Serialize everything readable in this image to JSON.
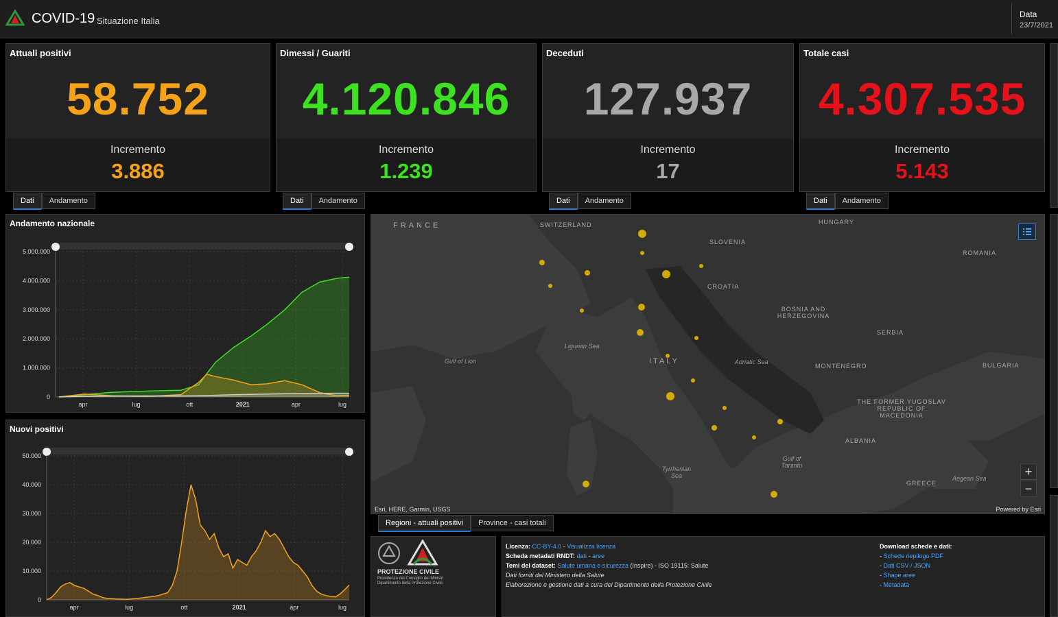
{
  "header": {
    "title": "COVID-19",
    "subtitle": "Situazione Italia",
    "date_label": "Data",
    "date_value": "23/7/2021"
  },
  "cards": [
    {
      "title": "Attuali positivi",
      "value": "58.752",
      "inc_label": "Incremento",
      "inc_value": "3.886",
      "color": "#f5a21b"
    },
    {
      "title": "Dimessi / Guariti",
      "value": "4.120.846",
      "inc_label": "Incremento",
      "inc_value": "1.239",
      "color": "#3ee022"
    },
    {
      "title": "Deceduti",
      "value": "127.937",
      "inc_label": "Incremento",
      "inc_value": "17",
      "color": "#a8a8a8"
    },
    {
      "title": "Totale casi",
      "value": "4.307.535",
      "inc_label": "Incremento",
      "inc_value": "5.143",
      "color": "#e3121b"
    }
  ],
  "card_tabs": {
    "dati": "Dati",
    "andamento": "Andamento"
  },
  "chart_data": [
    {
      "type": "area",
      "title": "Andamento nazionale",
      "x_ticks": [
        "apr",
        "lug",
        "ott",
        "2021",
        "apr",
        "lug"
      ],
      "y_ticks": [
        "5.000.000",
        "4.000.000",
        "3.000.000",
        "2.000.000",
        "1.000.000",
        "0"
      ],
      "ylim": [
        0,
        5000000
      ],
      "x_dates": [
        "2020-03-01",
        "2020-04-15",
        "2020-06-01",
        "2020-08-01",
        "2020-10-01",
        "2020-11-01",
        "2020-11-15",
        "2020-12-01",
        "2021-01-01",
        "2021-02-01",
        "2021-03-01",
        "2021-04-01",
        "2021-05-01",
        "2021-06-01",
        "2021-07-01",
        "2021-07-23"
      ],
      "series": [
        {
          "color": "#3ee022",
          "values": [
            0,
            80000,
            160000,
            200000,
            230000,
            420000,
            800000,
            1200000,
            1700000,
            2100000,
            2500000,
            3000000,
            3600000,
            3950000,
            4080000,
            4120846
          ]
        },
        {
          "color": "#f5a21b",
          "values": [
            0,
            100000,
            40000,
            15000,
            80000,
            500000,
            780000,
            700000,
            580000,
            420000,
            450000,
            560000,
            420000,
            150000,
            42000,
            58752
          ]
        },
        {
          "color": "#cccccc",
          "values": [
            0,
            22000,
            33000,
            35000,
            36000,
            40000,
            48000,
            58000,
            75000,
            90000,
            100000,
            110000,
            120000,
            126000,
            127700,
            127937
          ]
        }
      ]
    },
    {
      "type": "area",
      "title": "Nuovi positivi",
      "x_ticks": [
        "apr",
        "lug",
        "ott",
        "2021",
        "apr",
        "lug"
      ],
      "y_ticks": [
        "50.000",
        "40.000",
        "30.000",
        "20.000",
        "10.000",
        "0"
      ],
      "ylim": [
        0,
        50000
      ],
      "series": [
        {
          "color": "#f5a21b",
          "values": [
            0,
            800,
            2500,
            4500,
            5500,
            6000,
            5000,
            4500,
            4000,
            3000,
            2000,
            1500,
            800,
            500,
            400,
            300,
            250,
            200,
            300,
            400,
            600,
            800,
            1000,
            1200,
            1500,
            2000,
            2500,
            5000,
            10000,
            20000,
            31000,
            40000,
            35000,
            26000,
            24000,
            21000,
            23000,
            18000,
            15000,
            16000,
            11000,
            14000,
            13000,
            12000,
            15000,
            17000,
            20000,
            24000,
            22000,
            23000,
            21000,
            18000,
            15000,
            13000,
            12000,
            10000,
            8000,
            5000,
            3000,
            2000,
            1500,
            1200,
            1000,
            2000,
            3500,
            5143
          ]
        }
      ]
    }
  ],
  "map": {
    "labels": {
      "france": "FRANCE",
      "switzerland": "SWITZERLAND",
      "hungary": "HUNGARY",
      "slovenia": "SLOVENIA",
      "romania": "ROMANIA",
      "croatia": "CROATIA",
      "bosnia": "BOSNIA AND HERZEGOVINA",
      "serbia": "SERBIA",
      "montenegro": "MONTENEGRO",
      "bulgaria": "BULGARIA",
      "macedonia": "THE FORMER YUGOSLAV REPUBLIC OF MACEDONIA",
      "albania": "ALBANIA",
      "greece": "GREECE",
      "italy": "ITALY",
      "ligurian": "Ligurian Sea",
      "lion": "Gulf of Lion",
      "adriatic": "Adriatic Sea",
      "tyrrhenian": "Tyrrhenian Sea",
      "taranto": "Gulf of Taranto",
      "aegean": "Aegean Sea"
    },
    "attribution": "Esri, HERE, Garmin, USGS",
    "powered": "Powered by Esri",
    "zoom_in": "+",
    "zoom_out": "−",
    "dot_color": "#e6b800"
  },
  "map_tabs": {
    "regioni": "Regioni - attuali positivi",
    "province": "Province - casi totali"
  },
  "logo": {
    "name": "PROTEZIONE CIVILE",
    "line1": "Presidenza del Consiglio dei Ministri",
    "line2": "Dipartimento della Protezione Civile"
  },
  "info": {
    "licenza_label": "Licenza:",
    "licenza_link": "CC-BY-4.0",
    "sep": " - ",
    "visualizza": "Visualizza licenza",
    "scheda_label": "Scheda metadati RNDT:",
    "dati": "dati",
    "aree": "aree",
    "temi_label": "Temi del dataset:",
    "temi_link": "Salute umana e sicurezza",
    "temi_rest": "(Inspire) - ISO 19115: Salute",
    "forniti": "Dati forniti dal Ministero della Salute",
    "elaborazione": "Elaborazione e gestione dati a cura del Dipartimento della Protezione Civile",
    "download_title": "Download schede e dati:",
    "download_links": [
      "Schede riepilogo PDF",
      "Dati CSV / JSON",
      "Shape aree",
      "Metadata"
    ],
    "dash": "- "
  }
}
